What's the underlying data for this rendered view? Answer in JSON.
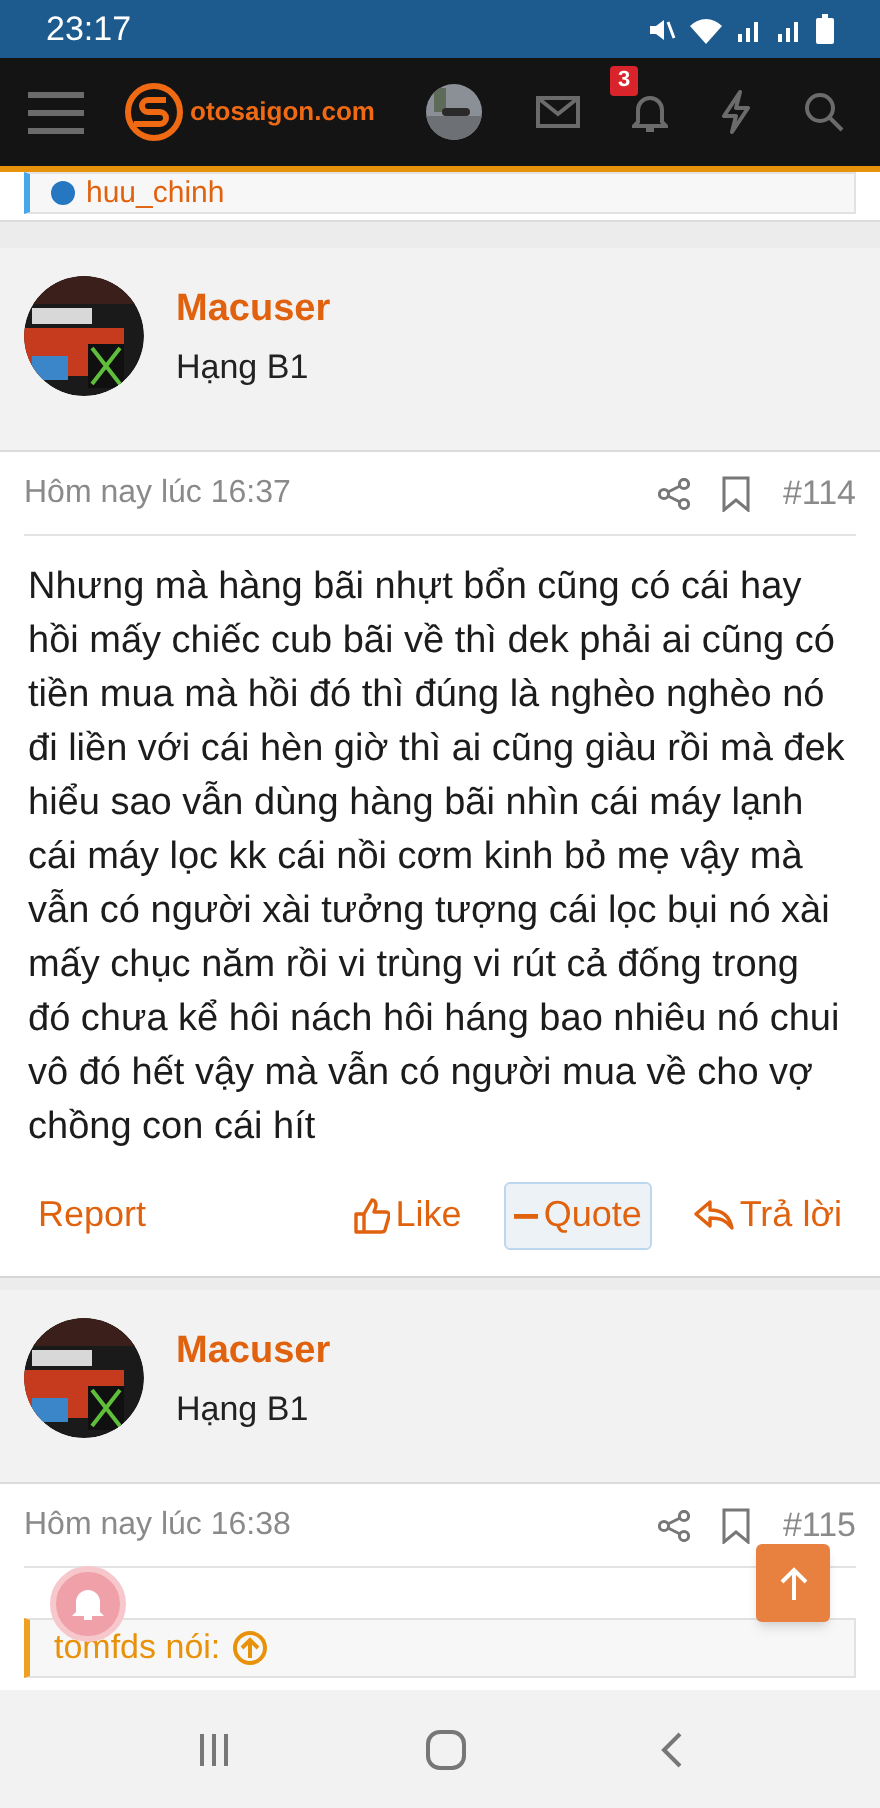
{
  "status_bar": {
    "time": "23:17"
  },
  "header": {
    "logo_text": "otosaigon.com",
    "notification_count": "3"
  },
  "previous_quote": {
    "author": "huu_chinh"
  },
  "posts": [
    {
      "author": "Macuser",
      "rank": "Hạng B1",
      "time": "Hôm nay lúc 16:37",
      "number": "#114",
      "body": "Nhưng mà hàng bãi nhựt bổn cũng có cái hay hồi mấy chiếc cub bãi về thì dek phải ai cũng có tiền mua mà hồi đó thì đúng là nghèo nghèo nó đi liền với cái hèn giờ thì ai cũng giàu rồi mà đek hiểu sao vẫn dùng hàng bãi nhìn cái máy lạnh cái máy lọc kk cái nồi cơm kinh bỏ mẹ vậy mà vẫn có người xài tưởng tượng cái lọc bụi nó xài mấy chục năm rồi vi trùng vi rút cả đống trong đó chưa kể hôi nách hôi háng bao nhiêu nó chui vô đó hết vậy mà vẫn có người mua về cho vợ chồng con cái hít",
      "actions": [
        {
          "kind": "report",
          "label": "Report",
          "selected": false
        },
        {
          "kind": "like",
          "label": "Like",
          "selected": false
        },
        {
          "kind": "quote",
          "label": "Quote",
          "selected": true
        },
        {
          "kind": "reply",
          "label": "Trả lời",
          "selected": false
        }
      ]
    },
    {
      "author": "Macuser",
      "rank": "Hạng B1",
      "time": "Hôm nay lúc 16:38",
      "number": "#115",
      "quote_author": "tomfds nói:"
    }
  ]
}
